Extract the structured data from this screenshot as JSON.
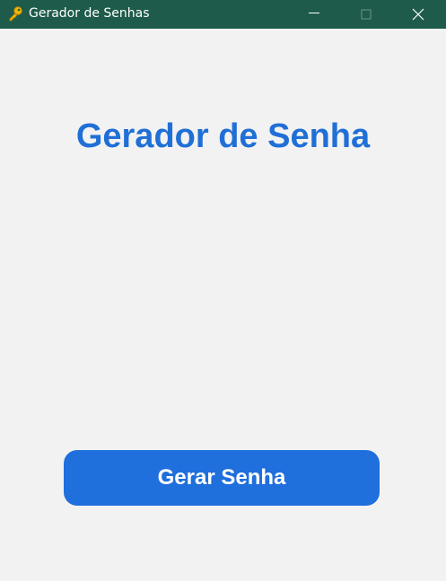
{
  "window": {
    "title": "Gerador de Senhas",
    "icon": "key-icon",
    "titlebar_color": "#1e5b4b"
  },
  "main": {
    "heading": "Gerador de Senha",
    "heading_color": "#1f6fd6",
    "generate_button_label": "Gerar Senha",
    "button_color": "#1f6fdc",
    "background_color": "#f2f2f2"
  }
}
